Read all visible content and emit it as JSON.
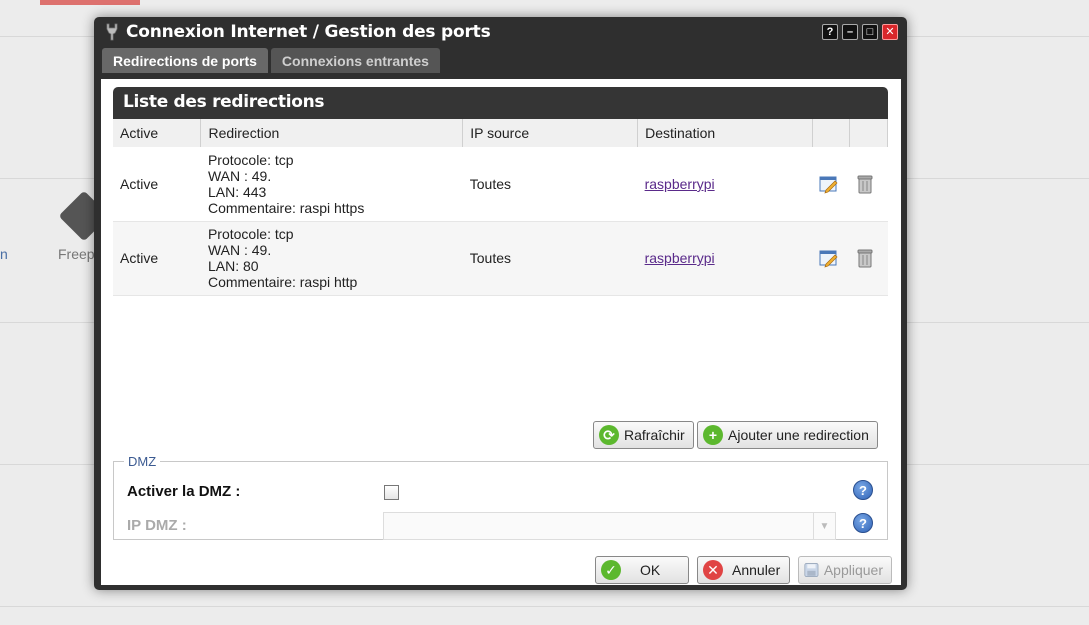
{
  "background": {
    "device_label": "Freep",
    "left_label": "n"
  },
  "window": {
    "title": "Connexion Internet / Gestion des ports",
    "buttons": {
      "help": "?",
      "minimize": "–",
      "maximize": "□",
      "close": "✕"
    }
  },
  "tabs": [
    {
      "label": "Redirections de ports",
      "active": true
    },
    {
      "label": "Connexions entrantes",
      "active": false
    }
  ],
  "list": {
    "title": "Liste des redirections",
    "columns": [
      "Active",
      "Redirection",
      "IP source",
      "Destination"
    ],
    "rows": [
      {
        "active": "Active",
        "protocole": "Protocole: tcp",
        "wan": "WAN : 49.",
        "lan": "LAN: 443",
        "commentaire": "Commentaire: raspi https",
        "ip_source": "Toutes",
        "destination": "raspberrypi"
      },
      {
        "active": "Active",
        "protocole": "Protocole: tcp",
        "wan": "WAN : 49.",
        "lan": "LAN: 80",
        "commentaire": "Commentaire: raspi http",
        "ip_source": "Toutes",
        "destination": "raspberrypi"
      }
    ]
  },
  "actions": {
    "refresh": "Rafraîchir",
    "add": "Ajouter une redirection"
  },
  "dmz": {
    "legend": "DMZ",
    "enable_label": "Activer la DMZ :",
    "enabled": false,
    "ip_label": "IP DMZ :",
    "ip_value": "",
    "help": "?"
  },
  "footer": {
    "ok": "OK",
    "cancel": "Annuler",
    "apply": "Appliquer"
  },
  "colors": {
    "window_bg": "#2f2f2f",
    "link": "#5a2a8a",
    "help_blue": "#2f63b7",
    "ok_green": "#5cb82e",
    "cancel_red": "#e04444"
  }
}
